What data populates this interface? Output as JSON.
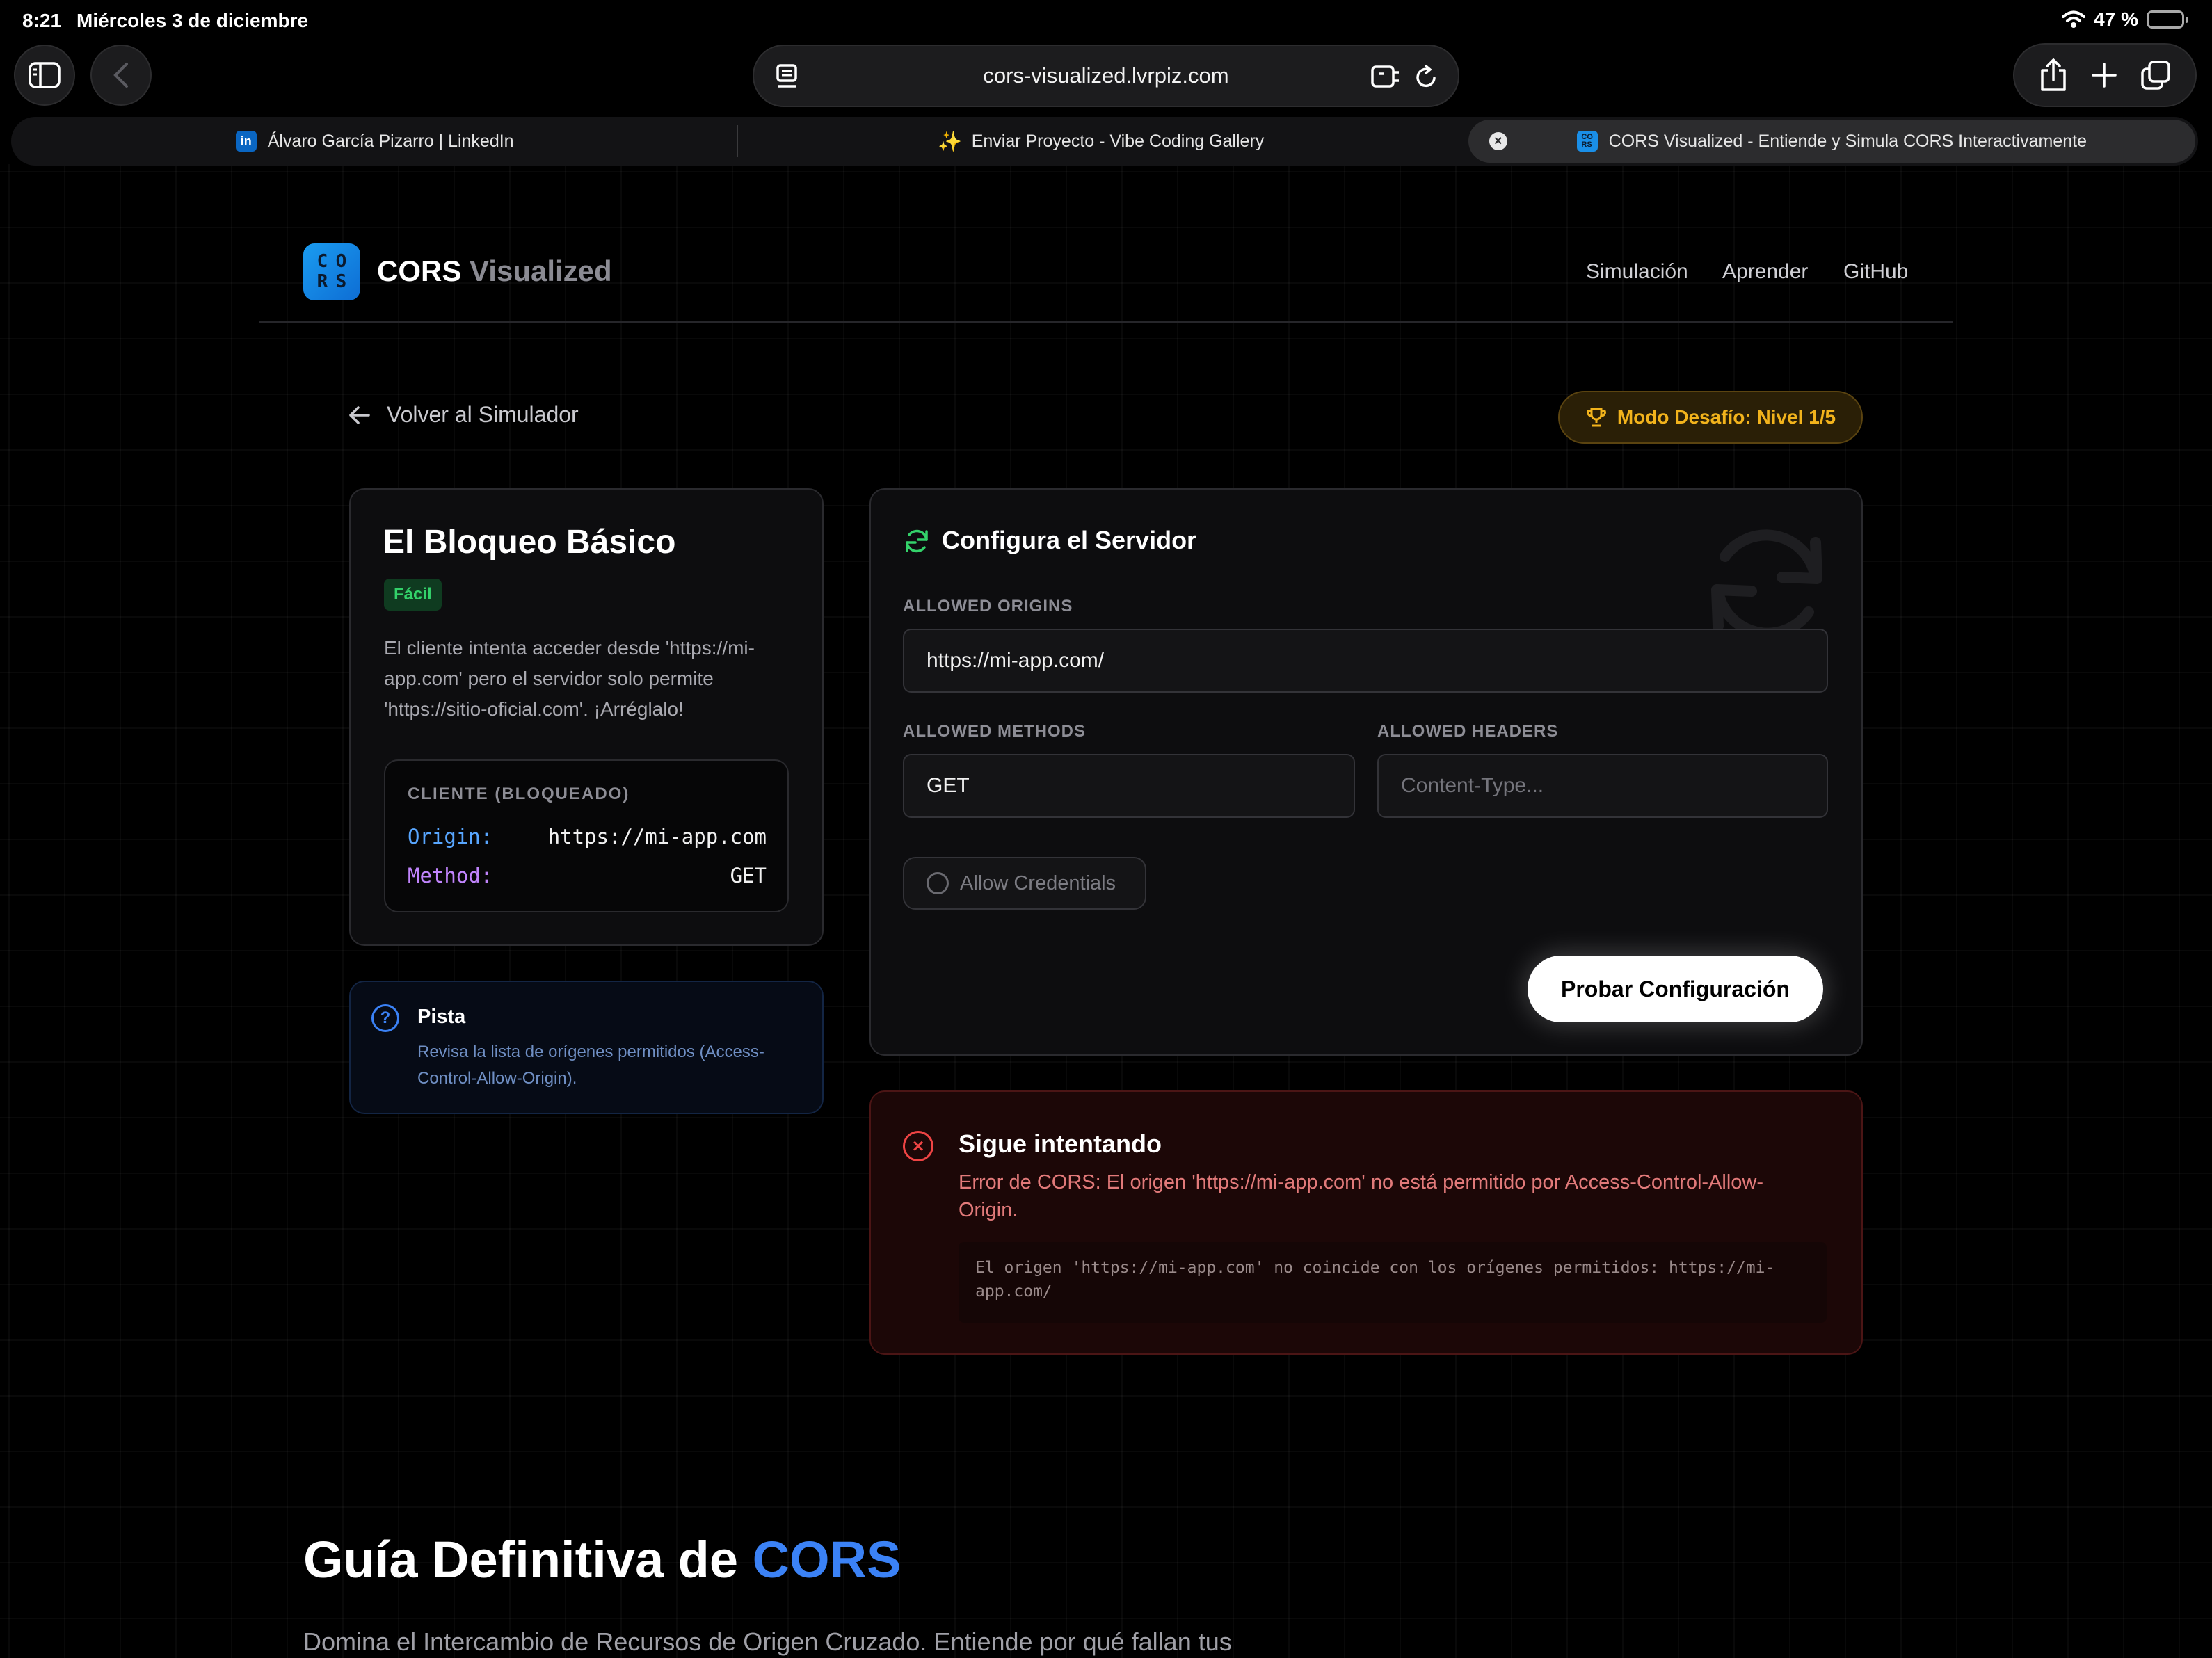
{
  "status_bar": {
    "time": "8:21",
    "date": "Miércoles 3 de diciembre",
    "battery": "47 %"
  },
  "browser": {
    "url": "cors-visualized.lvrpiz.com",
    "tabs": [
      {
        "label": "Álvaro García Pizarro | LinkedIn",
        "icon": "linkedin-icon"
      },
      {
        "label": "Enviar Proyecto - Vibe Coding Gallery",
        "icon": "sparkles-icon"
      },
      {
        "label": "CORS Visualized - Entiende y Simula CORS Interactivamente",
        "icon": "cors-favicon",
        "active": true
      }
    ]
  },
  "site": {
    "brand_main": "CORS",
    "brand_muted": "Visualized",
    "logo_letters": [
      "C",
      "O",
      "R",
      "S"
    ],
    "nav": [
      "Simulación",
      "Aprender",
      "GitHub"
    ]
  },
  "page": {
    "back_label": "Volver al Simulador",
    "challenge_badge": "Modo Desafío: Nivel 1/5",
    "level": {
      "title": "El Bloqueo Básico",
      "difficulty": "Fácil",
      "description": "El cliente intenta acceder desde 'https://mi-app.com' pero el servidor solo permite 'https://sitio-oficial.com'. ¡Arréglalo!",
      "client_title": "CLIENTE (BLOQUEADO)",
      "origin_key": "Origin:",
      "origin_value": "https://mi-app.com",
      "method_key": "Method:",
      "method_value": "GET"
    },
    "hint": {
      "title": "Pista",
      "text": "Revisa la lista de orígenes permitidos (Access-Control-Allow-Origin)."
    },
    "server": {
      "title": "Configura el Servidor",
      "allowed_origins_label": "ALLOWED ORIGINS",
      "allowed_origins_value": "https://mi-app.com/",
      "allowed_methods_label": "ALLOWED METHODS",
      "allowed_methods_value": "GET",
      "allowed_headers_label": "ALLOWED HEADERS",
      "allowed_headers_placeholder": "Content-Type...",
      "allow_credentials_label": "Allow Credentials",
      "test_button": "Probar Configuración"
    },
    "result": {
      "title": "Sigue intentando",
      "message": "Error de CORS: El origen 'https://mi-app.com' no está permitido por Access-Control-Allow-Origin.",
      "detail": "El origen 'https://mi-app.com' no coincide con los orígenes permitidos: https://mi-app.com/"
    },
    "guide": {
      "title_main": "Guía Definitiva de",
      "title_accent": "CORS",
      "subtitle": "Domina el Intercambio de Recursos de Origen Cruzado. Entiende por qué fallan tus"
    }
  },
  "colors": {
    "accent_blue": "#3b82f6",
    "success_green": "#33d26a",
    "warning_amber": "#f2b31c",
    "error_red": "#ef4444"
  }
}
